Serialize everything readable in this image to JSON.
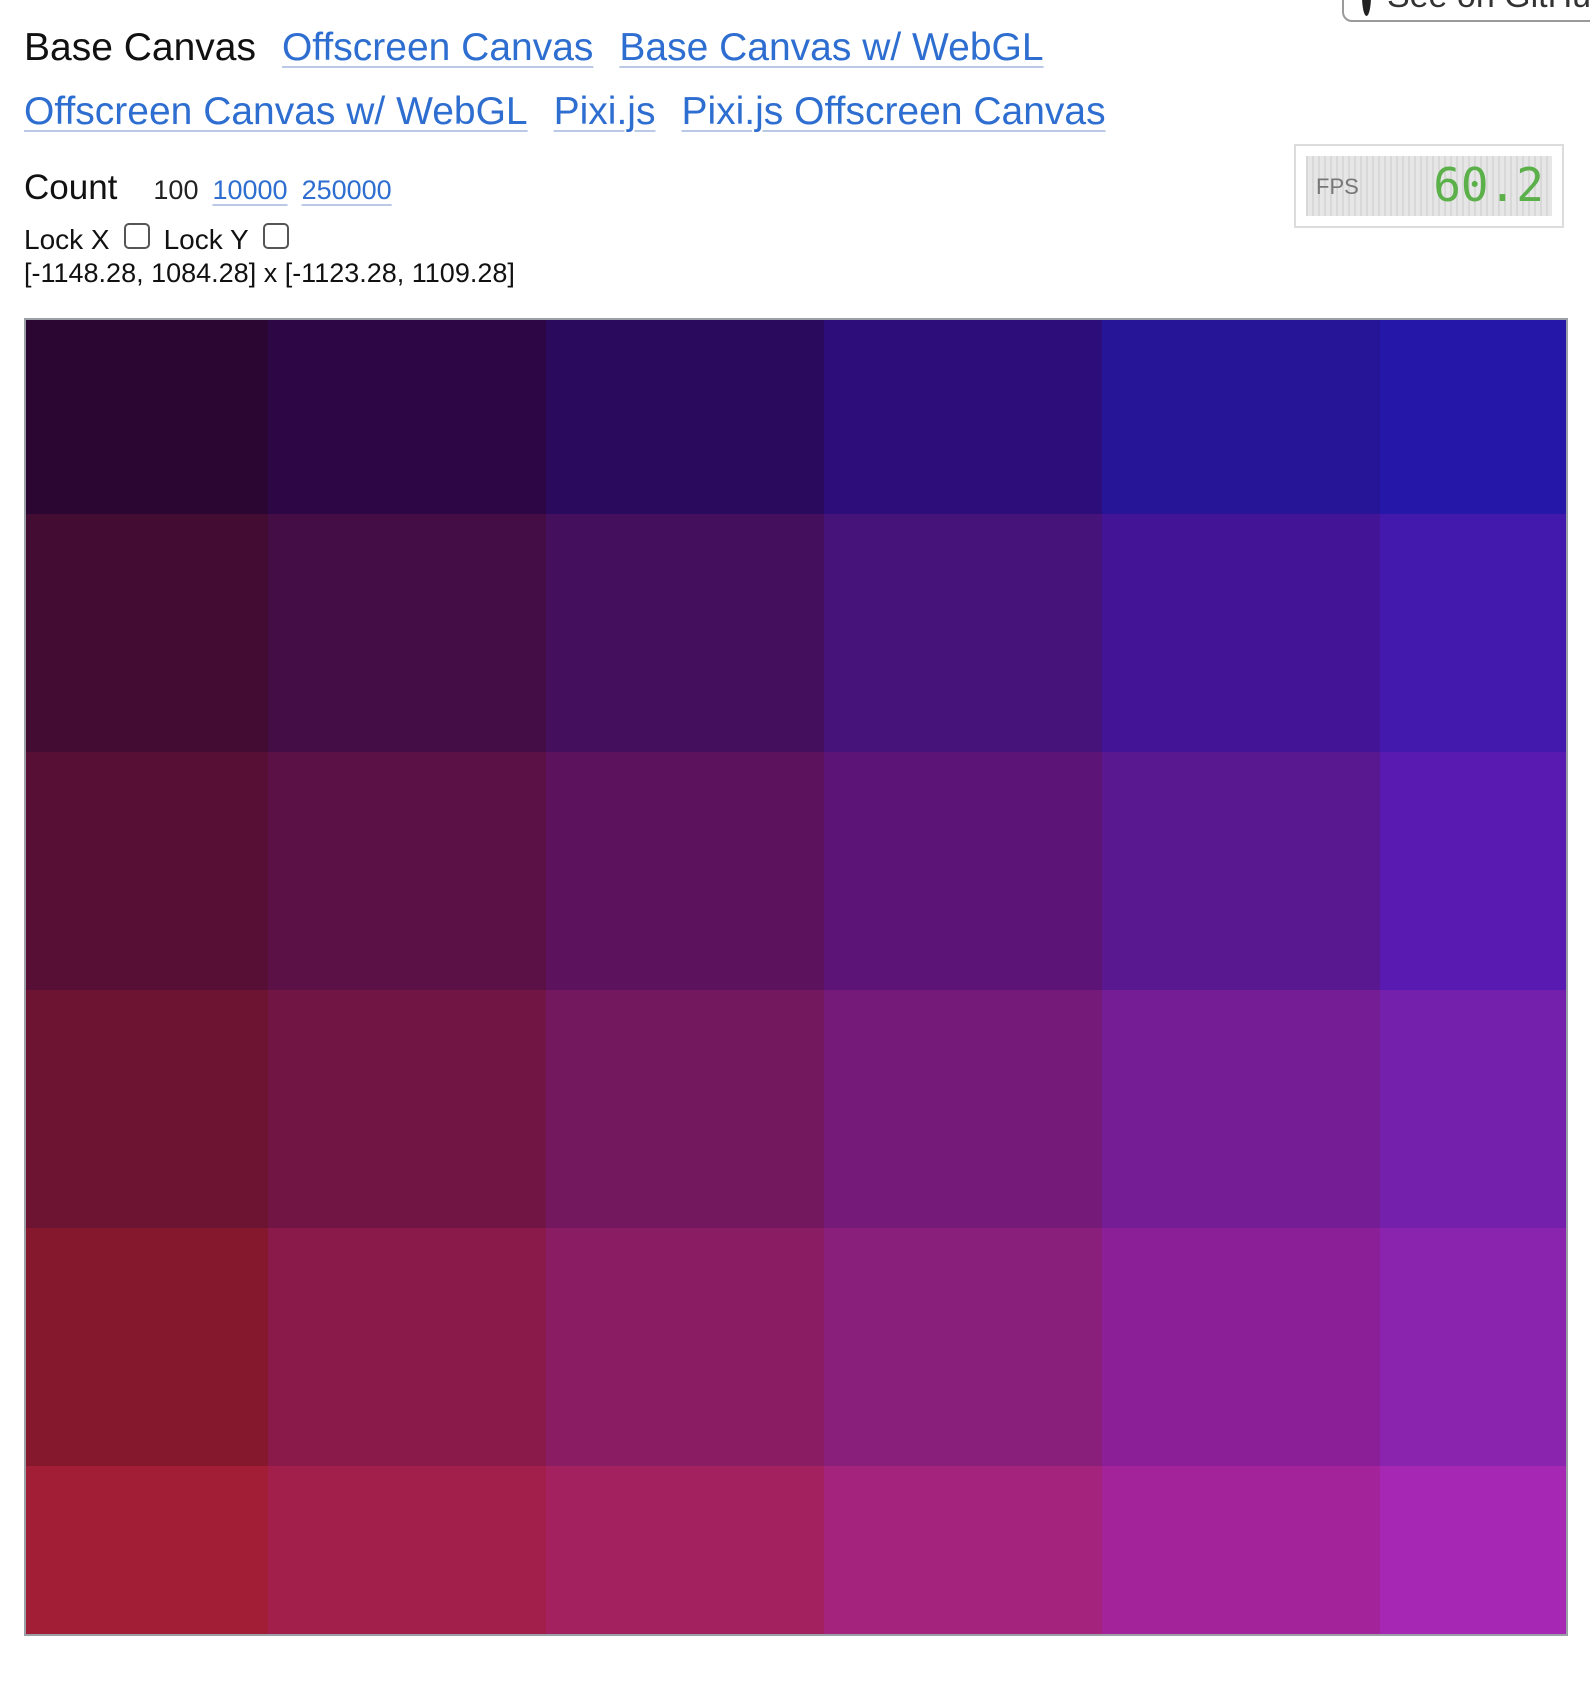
{
  "github_button": {
    "label": "See on GitHub",
    "icon": "github-icon"
  },
  "nav": {
    "current": "Base Canvas",
    "links": [
      "Offscreen Canvas",
      "Base Canvas w/ WebGL",
      "Offscreen Canvas w/ WebGL",
      "Pixi.js",
      "Pixi.js Offscreen Canvas"
    ]
  },
  "count": {
    "label": "Count",
    "selected": "100",
    "options": [
      "10000",
      "250000"
    ]
  },
  "locks": {
    "lock_x_label": "Lock X",
    "lock_x_checked": false,
    "lock_y_label": "Lock Y",
    "lock_y_checked": false
  },
  "range_text": "[-1148.28, 1084.28] x [-1123.28, 1109.28]",
  "fps": {
    "label": "FPS",
    "value": "60.2",
    "value_color": "#5bb04a"
  },
  "canvas": {
    "grid_rows": 6,
    "grid_cols": 6,
    "cell_colors": [
      [
        "#2b0632",
        "#2d0745",
        "#2a0a5d",
        "#2d0d79",
        "#271597",
        "#2518a8"
      ],
      [
        "#430c32",
        "#450d45",
        "#440f5d",
        "#45137a",
        "#431596",
        "#4319ad"
      ],
      [
        "#580f35",
        "#5b1046",
        "#5c125d",
        "#5c1577",
        "#5a1890",
        "#581ab0"
      ],
      [
        "#6e1433",
        "#711545",
        "#73175f",
        "#761a79",
        "#741d95",
        "#751fad"
      ],
      [
        "#86182e",
        "#891a4a",
        "#8a1c64",
        "#8a1e7b",
        "#8a1f97",
        "#8a23ae"
      ],
      [
        "#a21d36",
        "#a31f4b",
        "#a4215f",
        "#a3237d",
        "#a3249a",
        "#a627b4"
      ]
    ]
  }
}
